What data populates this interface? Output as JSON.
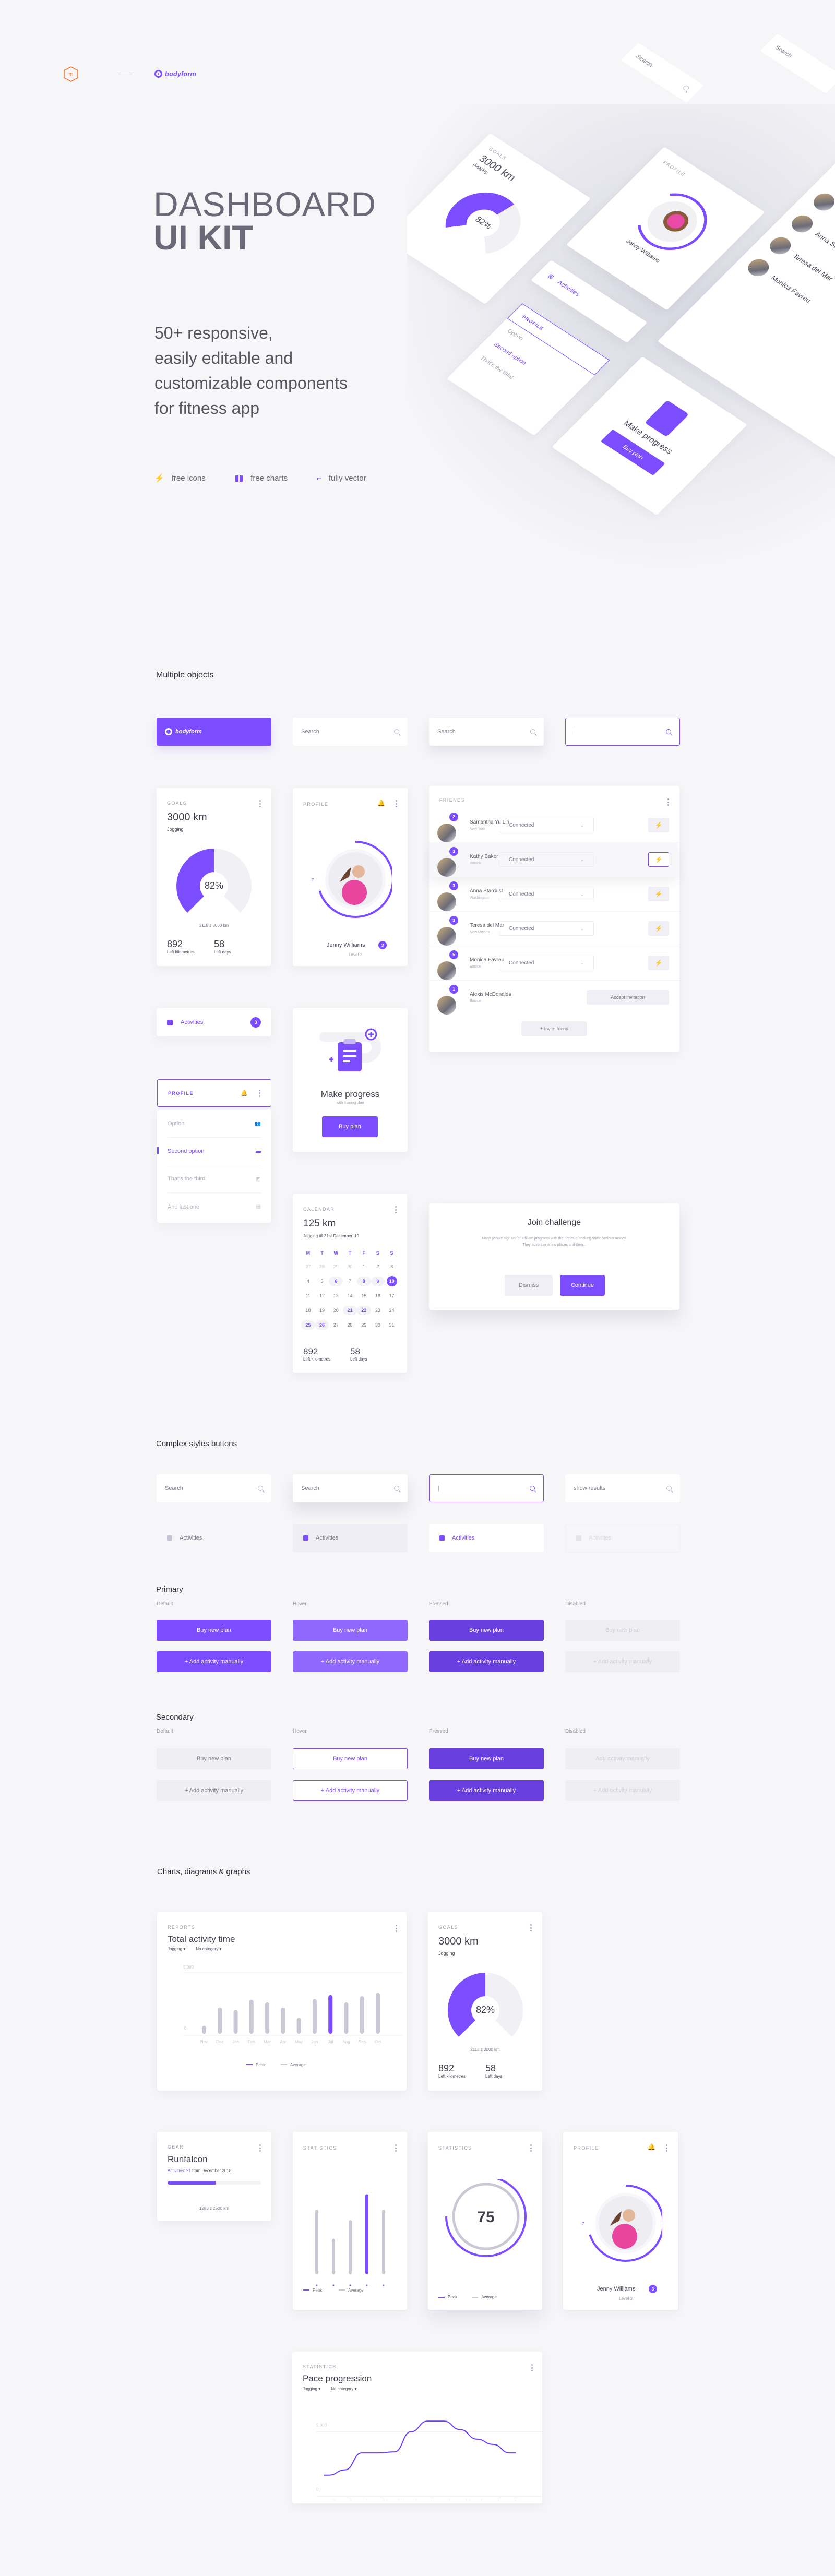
{
  "brand": {
    "studio_logo": "m",
    "product_name": "bodyform"
  },
  "hero": {
    "title_line1": "DASHBOARD",
    "title_line2": "UI KIT",
    "subtitle": [
      "50+ responsive,",
      "easily editable and",
      "customizable components",
      "for fitness app"
    ],
    "features": [
      {
        "icon": "lightning-icon",
        "label": "free icons"
      },
      {
        "icon": "bar-chart-icon",
        "label": "free charts"
      },
      {
        "icon": "vector-icon",
        "label": "fully vector"
      }
    ]
  },
  "colors": {
    "accent": "#7b4dff",
    "accent_hover": "#9068ff",
    "accent_pressed": "#6a3fe0",
    "background": "#f6f6f9",
    "text": "#4a4a5a",
    "muted": "#a09fae",
    "bar_grey": "#cbc8d6"
  },
  "multiple_objects": {
    "section_title": "Multiple objects",
    "brand_bar_label": "bodyform",
    "search_placeholder": "Search",
    "search_focused_value": "|",
    "goals": {
      "label": "GOALS",
      "value": "3000 km",
      "activity": "Jogging",
      "percent_label": "82%",
      "percent": 82,
      "progress_text": "2118 z 3000 km",
      "stat1_value": "892",
      "stat1_label": "Left kilometres",
      "stat2_value": "58",
      "stat2_label": "Left days"
    },
    "profile": {
      "label": "PROFILE",
      "name": "Jenny Williams",
      "level": "Level 3",
      "badge": "3",
      "ring_tick": "7",
      "progress": 0.7
    },
    "friends": {
      "label": "FRIENDS",
      "rows": [
        {
          "name": "Samantha Yu Lin",
          "city": "New York",
          "badge": "2",
          "status": "Connected"
        },
        {
          "name": "Kathy Baker",
          "city": "Boston",
          "badge": "3",
          "status": "Connected"
        },
        {
          "name": "Anna Stardust",
          "city": "Washington",
          "badge": "3",
          "status": "Connected"
        },
        {
          "name": "Teresa del Mar",
          "city": "New Mexico",
          "badge": "3",
          "status": "Connected"
        },
        {
          "name": "Monica Favreu",
          "city": "Boston",
          "badge": "5",
          "status": "Connected"
        },
        {
          "name": "Alexis McDonalds",
          "city": "Boston",
          "badge": "1",
          "status": "Accept invitation"
        }
      ],
      "invite_label": "+ Invite friend"
    },
    "activities": {
      "label": "Activities",
      "badge": "3"
    },
    "profile_menu": {
      "header": "PROFILE",
      "options": [
        "Option",
        "Second option",
        "That's the third",
        "And last one"
      ],
      "selected": 1
    },
    "make_progress": {
      "title": "Make progress",
      "subtitle": "with training plan",
      "button": "Buy plan"
    },
    "calendar": {
      "label": "CALENDAR",
      "value": "125 km",
      "subtitle": "Jogging till 31st December '19",
      "weekdays": [
        "M",
        "T",
        "W",
        "T",
        "F",
        "S",
        "S"
      ],
      "days": [
        "27",
        "28",
        "29",
        "30",
        "1",
        "2",
        "3",
        "4",
        "5",
        "6",
        "7",
        "8",
        "9",
        "10",
        "11",
        "12",
        "13",
        "14",
        "15",
        "16",
        "17",
        "18",
        "19",
        "20",
        "21",
        "22",
        "23",
        "24",
        "25",
        "26",
        "27",
        "28",
        "29",
        "30",
        "31"
      ],
      "muted_days": [
        0,
        1,
        2,
        3
      ],
      "highlighted_days": [
        12,
        11,
        9,
        24,
        25,
        28,
        29
      ],
      "selected_day_index": 13,
      "stat1_value": "892",
      "stat1_label": "Left kilometres",
      "stat2_value": "58",
      "stat2_label": "Left days"
    },
    "join": {
      "title": "Join challenge",
      "body_line1": "Many people sign up for affiliate programs with the hopes of making some serious money.",
      "body_line2": "They advertise a few places and then...",
      "dismiss": "Dismiss",
      "continue": "Continue"
    }
  },
  "complex_buttons": {
    "section_title": "Complex styles buttons",
    "search": [
      "Search",
      "Search",
      "|",
      "show results"
    ],
    "activities": [
      "Activities",
      "Activities",
      "Activities",
      "Activities"
    ]
  },
  "primary": {
    "title": "Primary",
    "states": [
      "Default",
      "Hover",
      "Pressed",
      "Disabled"
    ],
    "btn1": "Buy new plan",
    "btn2": "+ Add activity manually"
  },
  "secondary": {
    "title": "Secondary",
    "states": [
      "Default",
      "Hover",
      "Pressed",
      "Disabled"
    ],
    "btn1": "Buy new plan",
    "btn2": "+ Add activity manually",
    "disabled_btn1": "Add activity manually"
  },
  "charts_section": {
    "title": "Charts, diagrams & graphs"
  },
  "gear": {
    "label": "GEAR",
    "title": "Runfalcon",
    "activities_prefix": "Activities: 91",
    "activities_suffix": " from December 2018",
    "progress_text": "1283 z 2500 km",
    "progress": 0.513
  },
  "chart_data": [
    {
      "type": "bar",
      "label": "REPORTS",
      "title": "Total activity time",
      "filters": [
        "Jogging",
        "No category"
      ],
      "categories": [
        "Nov",
        "Dec",
        "Jan",
        "Feb",
        "Mar",
        "Apr",
        "May",
        "Jun",
        "Jul",
        "Aug",
        "Sep",
        "Oct"
      ],
      "values": [
        700,
        2300,
        2100,
        3000,
        2750,
        2300,
        1400,
        3050,
        3400,
        2750,
        3300,
        3600
      ],
      "peak_index": 8,
      "ylim": [
        0,
        5000
      ],
      "yticks": [
        "0",
        "5.000"
      ],
      "legend": [
        "Peak",
        "Average"
      ],
      "legend_position": "bottom"
    },
    {
      "type": "bar",
      "label": "STATISTICS",
      "categories": [
        "1",
        "2",
        "3",
        "4",
        "5"
      ],
      "values": [
        80,
        44,
        67,
        99,
        80
      ],
      "peak_index": 3,
      "ylim": [
        0,
        100
      ],
      "legend": [
        "Peak",
        "Average"
      ],
      "legend_position": "bottom"
    },
    {
      "type": "pie",
      "label": "STATISTICS",
      "center_value": "75",
      "series": [
        {
          "name": "Peak",
          "value": 75
        },
        {
          "name": "Average",
          "value": 100
        }
      ],
      "legend": [
        "Peak",
        "Average"
      ],
      "legend_position": "bottom"
    },
    {
      "type": "line",
      "label": "STATISTICS",
      "title": "Pace progression",
      "filters": [
        "Jogging",
        "No category"
      ],
      "categories": [
        "Nov",
        "Dec",
        "Jan",
        "Feb",
        "Mar",
        "Apr",
        "May",
        "Jun",
        "Jul",
        "Aug",
        "Sep",
        "Oct"
      ],
      "values": [
        900,
        1400,
        3000,
        3000,
        3100,
        5000,
        6000,
        6000,
        5200,
        4300,
        3800,
        3000
      ],
      "ylim": [
        0,
        7000
      ],
      "yticks": [
        "0",
        "5.000"
      ]
    }
  ]
}
